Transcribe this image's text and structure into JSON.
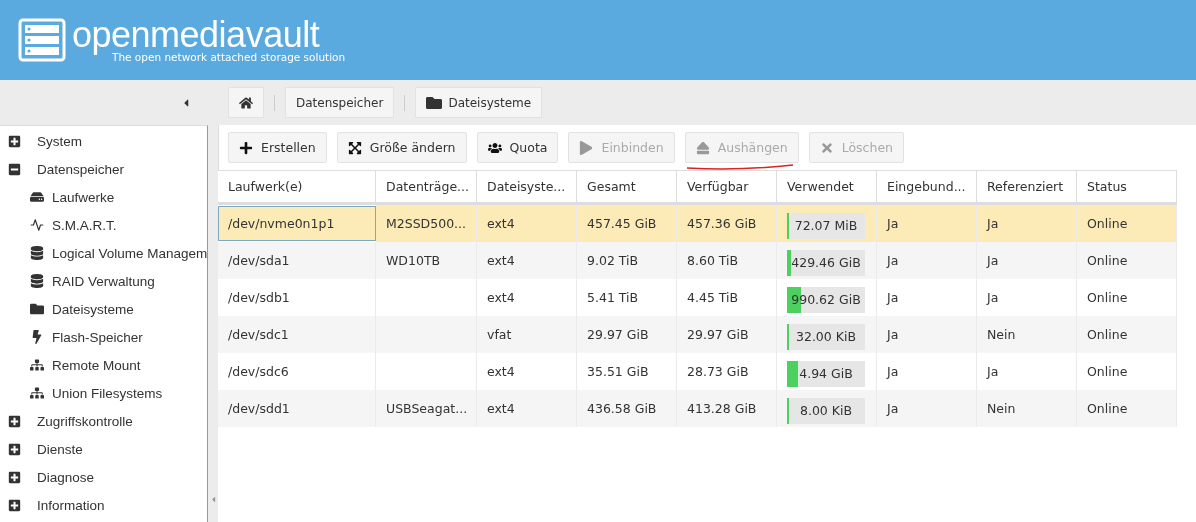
{
  "header": {
    "title": "openmediavault",
    "subtitle": "The open network attached storage solution"
  },
  "sidebar": {
    "items": [
      {
        "label": "System",
        "expanded": false
      },
      {
        "label": "Datenspeicher",
        "expanded": true,
        "children": [
          {
            "label": "Laufwerke",
            "selected": false
          },
          {
            "label": "S.M.A.R.T.",
            "selected": false
          },
          {
            "label": "Logical Volume Managem",
            "selected": false
          },
          {
            "label": "RAID Verwaltung",
            "selected": false
          },
          {
            "label": "Dateisysteme",
            "selected": false
          },
          {
            "label": "Flash-Speicher",
            "selected": false
          },
          {
            "label": "Remote Mount",
            "selected": false
          },
          {
            "label": "Union Filesystems",
            "selected": false
          }
        ]
      },
      {
        "label": "Zugriffskontrolle",
        "expanded": false
      },
      {
        "label": "Dienste",
        "expanded": false
      },
      {
        "label": "Diagnose",
        "expanded": false
      },
      {
        "label": "Information",
        "expanded": false
      }
    ]
  },
  "breadcrumb": [
    "Datenspeicher",
    "Dateisysteme"
  ],
  "toolbar": [
    {
      "label": "Erstellen",
      "disabled": false,
      "underlined": false
    },
    {
      "label": "Größe ändern",
      "disabled": false,
      "underlined": false
    },
    {
      "label": "Quota",
      "disabled": false,
      "underlined": false
    },
    {
      "label": "Einbinden",
      "disabled": true,
      "underlined": false
    },
    {
      "label": "Aushängen",
      "disabled": true,
      "underlined": true
    },
    {
      "label": "Löschen",
      "disabled": true,
      "underlined": false
    }
  ],
  "table": {
    "columns": [
      "Laufwerk(e)",
      "Datenträge...",
      "Dateisyste...",
      "Gesamt",
      "Verfügbar",
      "Verwendet",
      "Eingebund...",
      "Referenziert",
      "Status"
    ],
    "rows": [
      {
        "selected": true,
        "cells": [
          "/dev/nvme0n1p1",
          "M2SSD500...",
          "ext4",
          "457.45 GiB",
          "457.36 GiB"
        ],
        "used": {
          "level": 0.01,
          "reading": "72.07 MiB"
        },
        "rest": [
          "Ja",
          "Ja",
          "Online"
        ]
      },
      {
        "selected": false,
        "cells": [
          "/dev/sda1",
          "WD10TB",
          "ext4",
          "9.02 TiB",
          "8.60 TiB"
        ],
        "used": {
          "level": 0.05,
          "reading": "429.46 GiB"
        },
        "rest": [
          "Ja",
          "Ja",
          "Online"
        ]
      },
      {
        "selected": false,
        "cells": [
          "/dev/sdb1",
          "",
          "ext4",
          "5.41 TiB",
          "4.45 TiB"
        ],
        "used": {
          "level": 0.18,
          "reading": "990.62 GiB"
        },
        "rest": [
          "Ja",
          "Ja",
          "Online"
        ]
      },
      {
        "selected": false,
        "cells": [
          "/dev/sdc1",
          "",
          "vfat",
          "29.97 GiB",
          "29.97 GiB"
        ],
        "used": {
          "level": 0.01,
          "reading": "32.00 KiB"
        },
        "rest": [
          "Ja",
          "Nein",
          "Online"
        ]
      },
      {
        "selected": false,
        "cells": [
          "/dev/sdc6",
          "",
          "ext4",
          "35.51 GiB",
          "28.73 GiB"
        ],
        "used": {
          "level": 0.14,
          "reading": "4.94 GiB"
        },
        "rest": [
          "Ja",
          "Ja",
          "Online"
        ]
      },
      {
        "selected": false,
        "cells": [
          "/dev/sdd1",
          "USBSeagat...",
          "ext4",
          "436.58 GiB",
          "413.28 GiB"
        ],
        "used": {
          "level": 0.01,
          "reading": "8.00 KiB"
        },
        "rest": [
          "Ja",
          "Nein",
          "Online"
        ]
      }
    ]
  }
}
